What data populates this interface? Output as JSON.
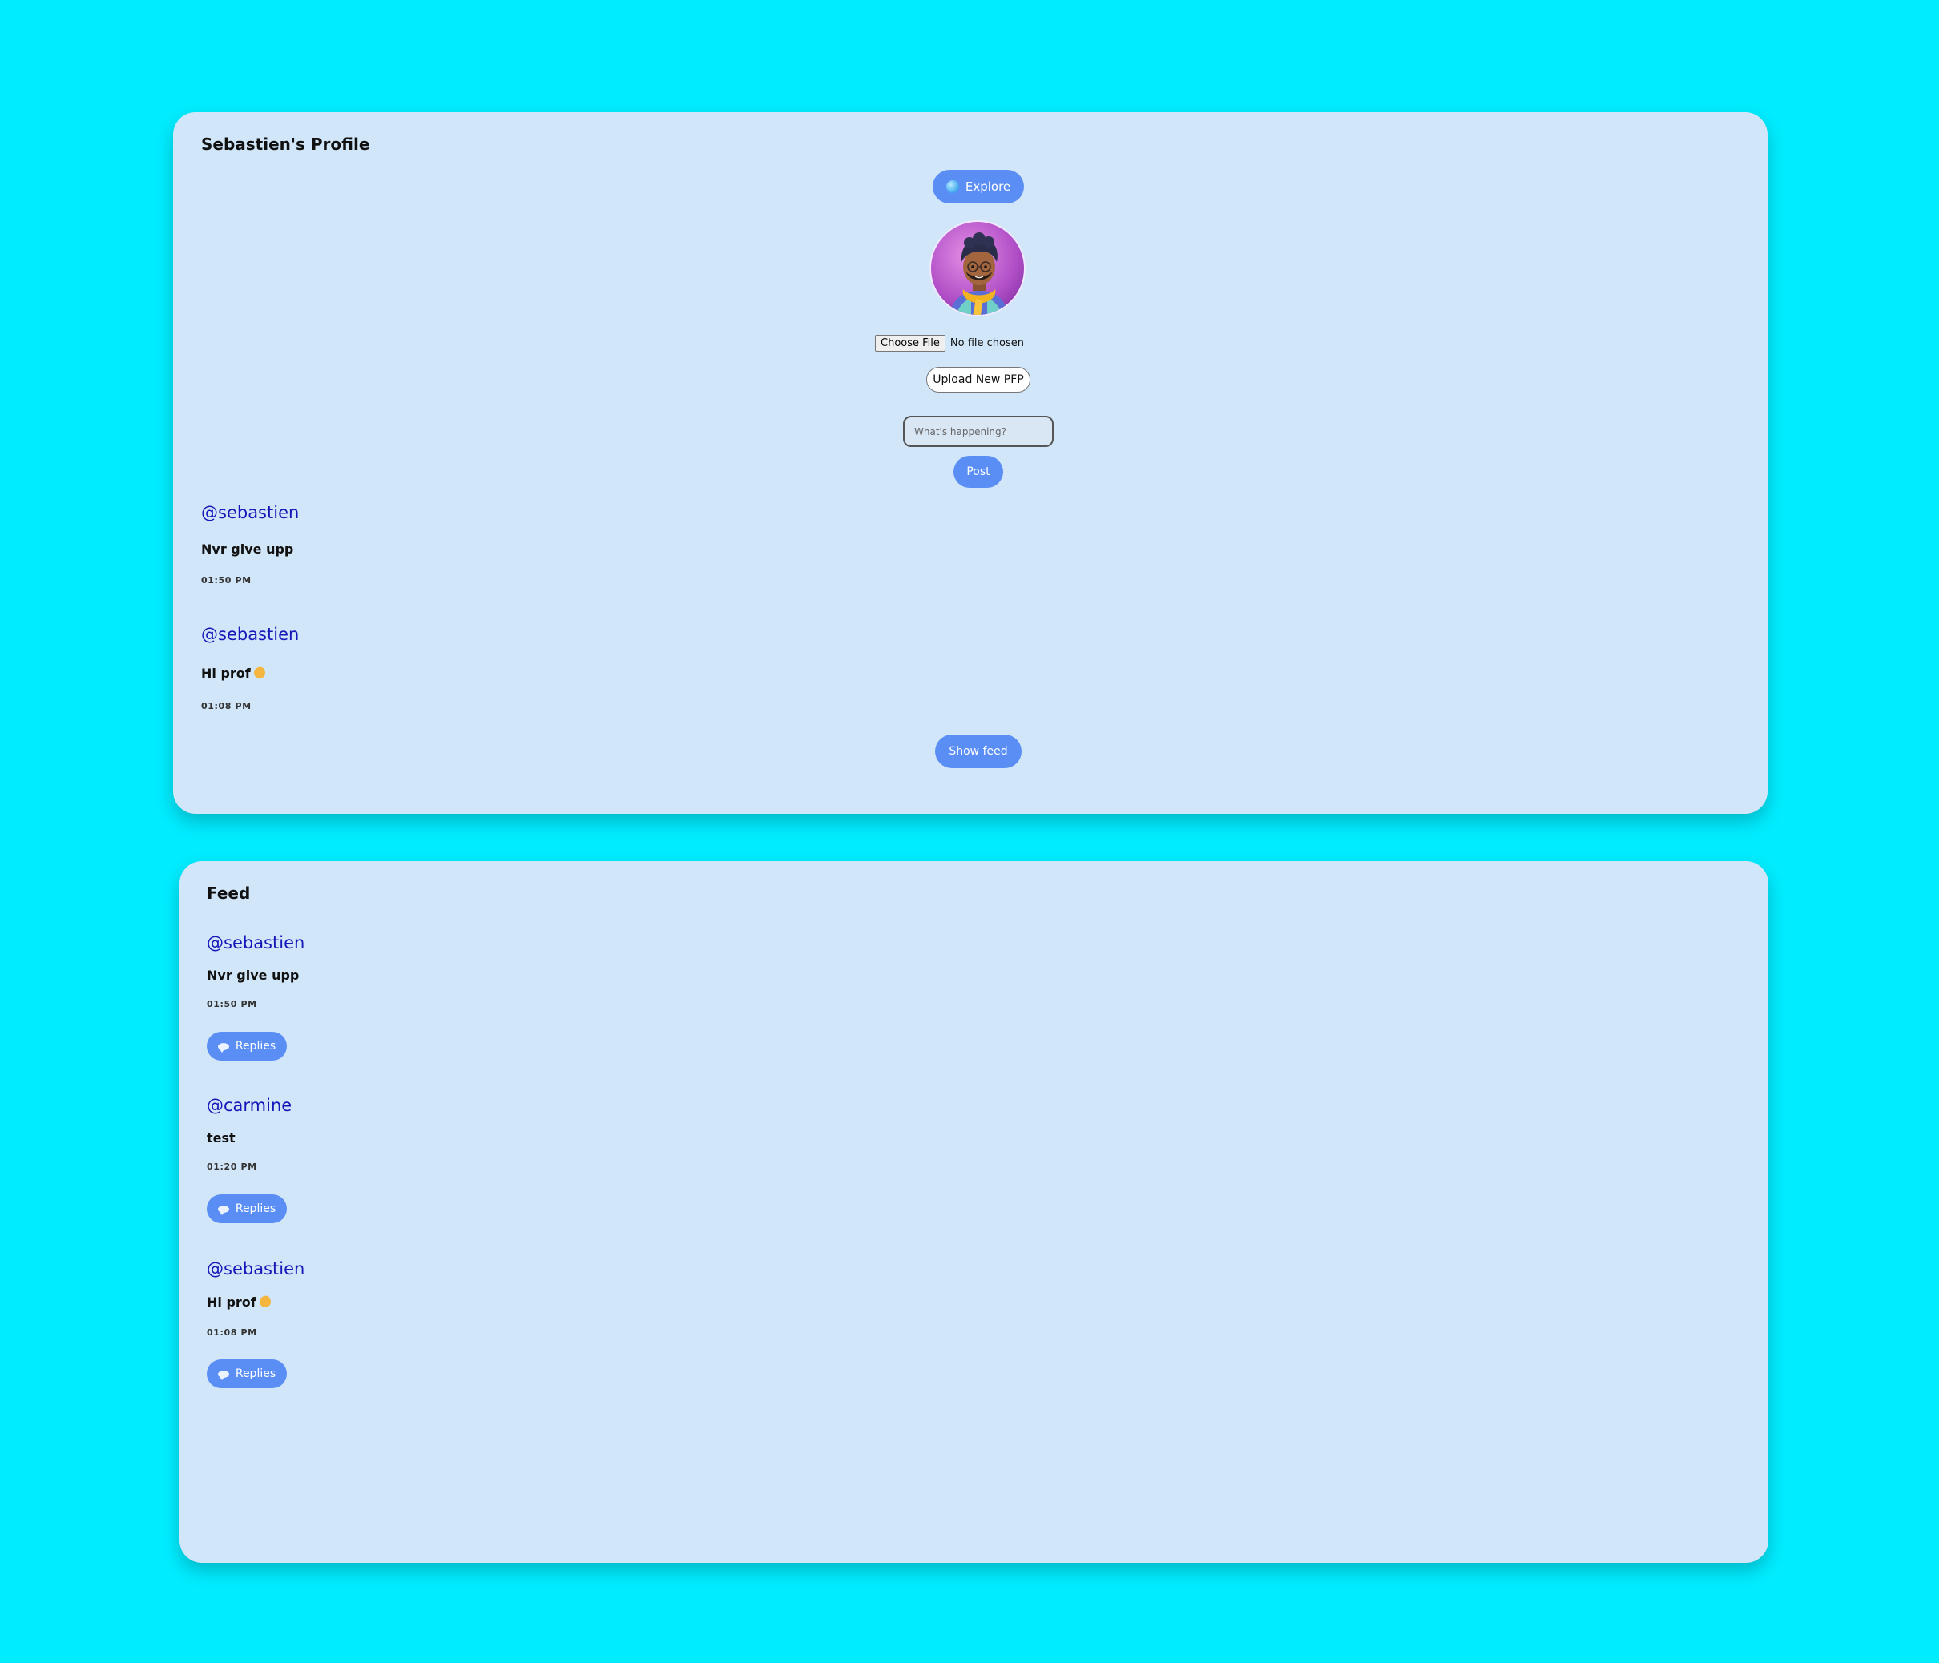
{
  "profile": {
    "title": "Sebastien's Profile",
    "explore_label": "Explore",
    "explore_icon": "globe-icon",
    "avatar_alt": "profile picture",
    "choose_file_label": "Choose File",
    "no_file_text": "No file chosen",
    "upload_label": "Upload New PFP",
    "post_placeholder": "What's happening?",
    "post_label": "Post",
    "posts": [
      {
        "username": "@sebastien",
        "text": "Nvr give upp",
        "time": "01:50 PM"
      },
      {
        "username": "@sebastien",
        "text": "Hi prof",
        "emoji": "waving-hand-icon",
        "time": "01:08 PM"
      }
    ],
    "show_feed_label": "Show feed"
  },
  "feed": {
    "title": "Feed",
    "replies_icon": "speech-bubble-icon",
    "posts": [
      {
        "username": "@sebastien",
        "text": "Nvr give upp",
        "time": "01:50 PM",
        "replies_label": "Replies"
      },
      {
        "username": "@carmine",
        "text": "test",
        "time": "01:20 PM",
        "replies_label": "Replies"
      },
      {
        "username": "@sebastien",
        "text": "Hi prof",
        "emoji": "waving-hand-icon",
        "time": "01:08 PM",
        "replies_label": "Replies"
      }
    ]
  },
  "colors": {
    "page_background": "#00ecff",
    "card_background": "#d1e6f9",
    "accent_button": "#5a8ef5",
    "username_link": "#1518b8"
  }
}
